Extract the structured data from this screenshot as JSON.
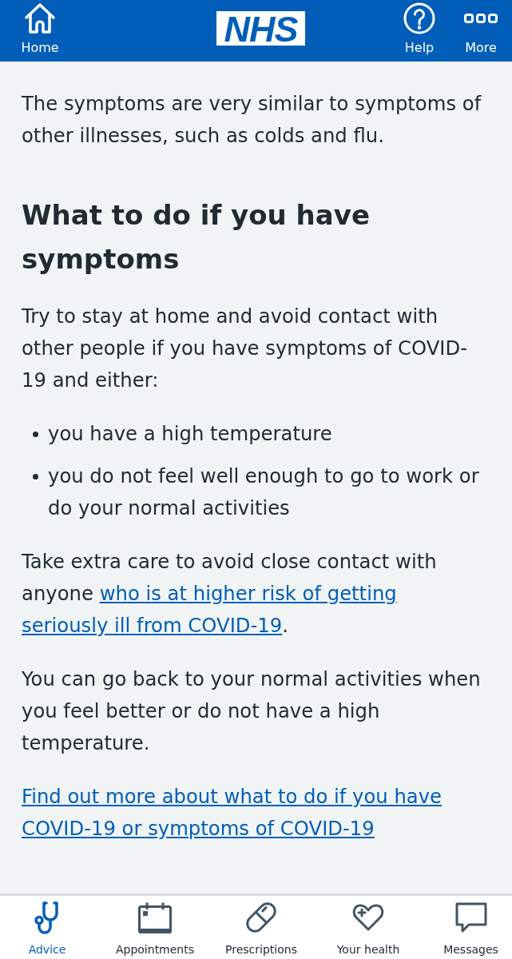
{
  "header": {
    "home": {
      "label": "Home"
    },
    "logo": "NHS",
    "actions": [
      {
        "kind": "help",
        "label": "Help"
      },
      {
        "kind": "more",
        "label": "More"
      }
    ]
  },
  "content": [
    {
      "kind": "paragraph",
      "parts": [
        {
          "kind": "text",
          "text": "The symptoms are very similar to symptoms of other illnesses, such as colds and flu."
        }
      ]
    },
    {
      "kind": "heading",
      "text": "What to do if you have symptoms"
    },
    {
      "kind": "paragraph",
      "parts": [
        {
          "kind": "text",
          "text": "Try to stay at home and avoid contact with other people if you have symptoms of COVID-19 and either:"
        }
      ]
    },
    {
      "kind": "list",
      "items": [
        "you have a high temperature",
        "you do not feel well enough to go to work or do your normal activities"
      ]
    },
    {
      "kind": "paragraph",
      "parts": [
        {
          "kind": "text",
          "text": "Take extra care to avoid close contact with anyone"
        },
        {
          "kind": "link",
          "text": "who is at higher risk of getting"
        },
        {
          "kind": "link",
          "text": "seriously ill from COVID-19"
        },
        {
          "kind": "text",
          "text": "."
        }
      ]
    },
    {
      "kind": "paragraph",
      "parts": [
        {
          "kind": "text",
          "text": "You can go back to your normal activities when you feel better or do not have a high temperature."
        }
      ]
    },
    {
      "kind": "link",
      "text": "Find out more about what to do if you have COVID-19 or symptoms of COVID-19"
    }
  ],
  "tab_bar": {
    "tabs": [
      {
        "kind": "stethoscope",
        "label": "Advice",
        "selected": true
      },
      {
        "kind": "calendar",
        "label": "Appointments",
        "selected": false
      },
      {
        "kind": "pill",
        "label": "Prescriptions",
        "selected": false
      },
      {
        "kind": "heart",
        "label": "Your health",
        "selected": false
      },
      {
        "kind": "bubble",
        "label": "Messages",
        "selected": false
      }
    ]
  }
}
